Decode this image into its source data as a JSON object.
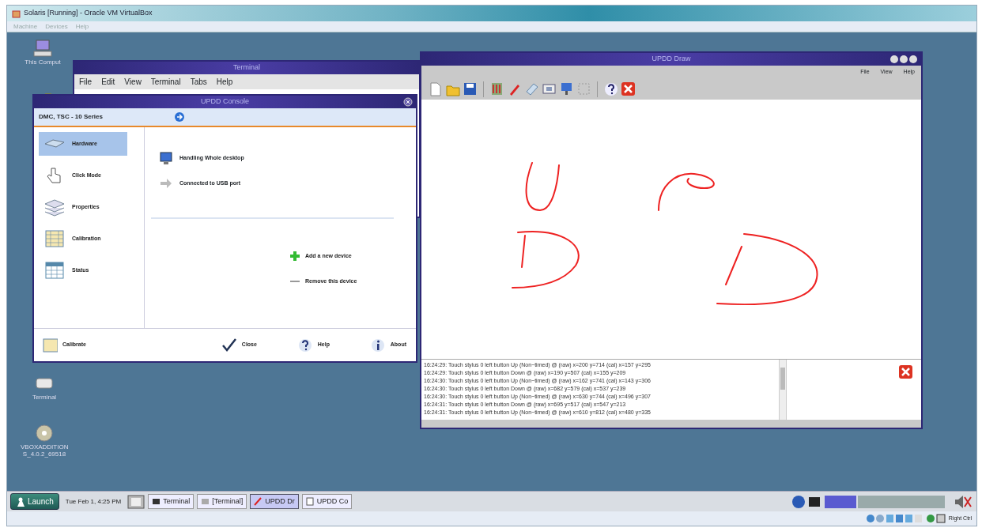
{
  "host_window": {
    "title": "Solaris [Running] - Oracle VM VirtualBox",
    "menu": [
      "Machine",
      "Devices",
      "Help"
    ]
  },
  "desktop_icons": [
    {
      "label": "This Comput"
    },
    {
      "label": "Terminal"
    },
    {
      "label": "VBOXADDITION S_4.0.2_69518"
    }
  ],
  "terminal_window": {
    "title": "Terminal",
    "menu": [
      "File",
      "Edit",
      "View",
      "Terminal",
      "Tabs",
      "Help"
    ]
  },
  "console_window": {
    "title": "UPDD Console",
    "device": "DMC, TSC - 10 Series",
    "nav": [
      {
        "label": "Hardware",
        "selected": true
      },
      {
        "label": "Click Mode",
        "selected": false
      },
      {
        "label": "Properties",
        "selected": false
      },
      {
        "label": "Calibration",
        "selected": false
      },
      {
        "label": "Status",
        "selected": false
      }
    ],
    "info": [
      "Handling Whole desktop",
      "Connected to USB port"
    ],
    "actions": [
      "Add a new device",
      "Remove this device"
    ],
    "footer": [
      "Calibrate",
      "Close",
      "Help",
      "About"
    ]
  },
  "draw_window": {
    "title": "UPDD Draw",
    "menu": [
      "File",
      "View",
      "Help"
    ],
    "log": [
      "16:24:29: Touch stylus 0 left button Up (Non−timed) @ (raw) x=200 y=714 (cal) x=157 y=295",
      "16:24:29: Touch stylus 0 left button Down  @ (raw) x=190 y=507 (cal) x=155 y=209",
      "16:24:30: Touch stylus 0 left button Up (Non−timed) @ (raw) x=162 y=741 (cal) x=143 y=306",
      "16:24:30: Touch stylus 0 left button Down  @ (raw) x=682 y=579 (cal) x=537 y=239",
      "16:24:30: Touch stylus 0 left button Up (Non−timed) @ (raw) x=630 y=744 (cal) x=496 y=307",
      "16:24:31: Touch stylus 0 left button Down  @ (raw) x=695 y=517 (cal) x=547 y=213",
      "16:24:31: Touch stylus 0 left button Up (Non−timed) @ (raw) x=610 y=812 (cal) x=480 y=335"
    ]
  },
  "taskbar": {
    "launch": "Launch",
    "clock": "Tue Feb  1,  4:25 PM",
    "tasks": [
      {
        "label": "Terminal",
        "selected": false
      },
      {
        "label": "[Terminal]",
        "selected": false
      },
      {
        "label": "UPDD Dr",
        "selected": true
      },
      {
        "label": "UPDD Co",
        "selected": false
      }
    ]
  },
  "status_bar": {
    "host_key": "Right Ctrl"
  }
}
